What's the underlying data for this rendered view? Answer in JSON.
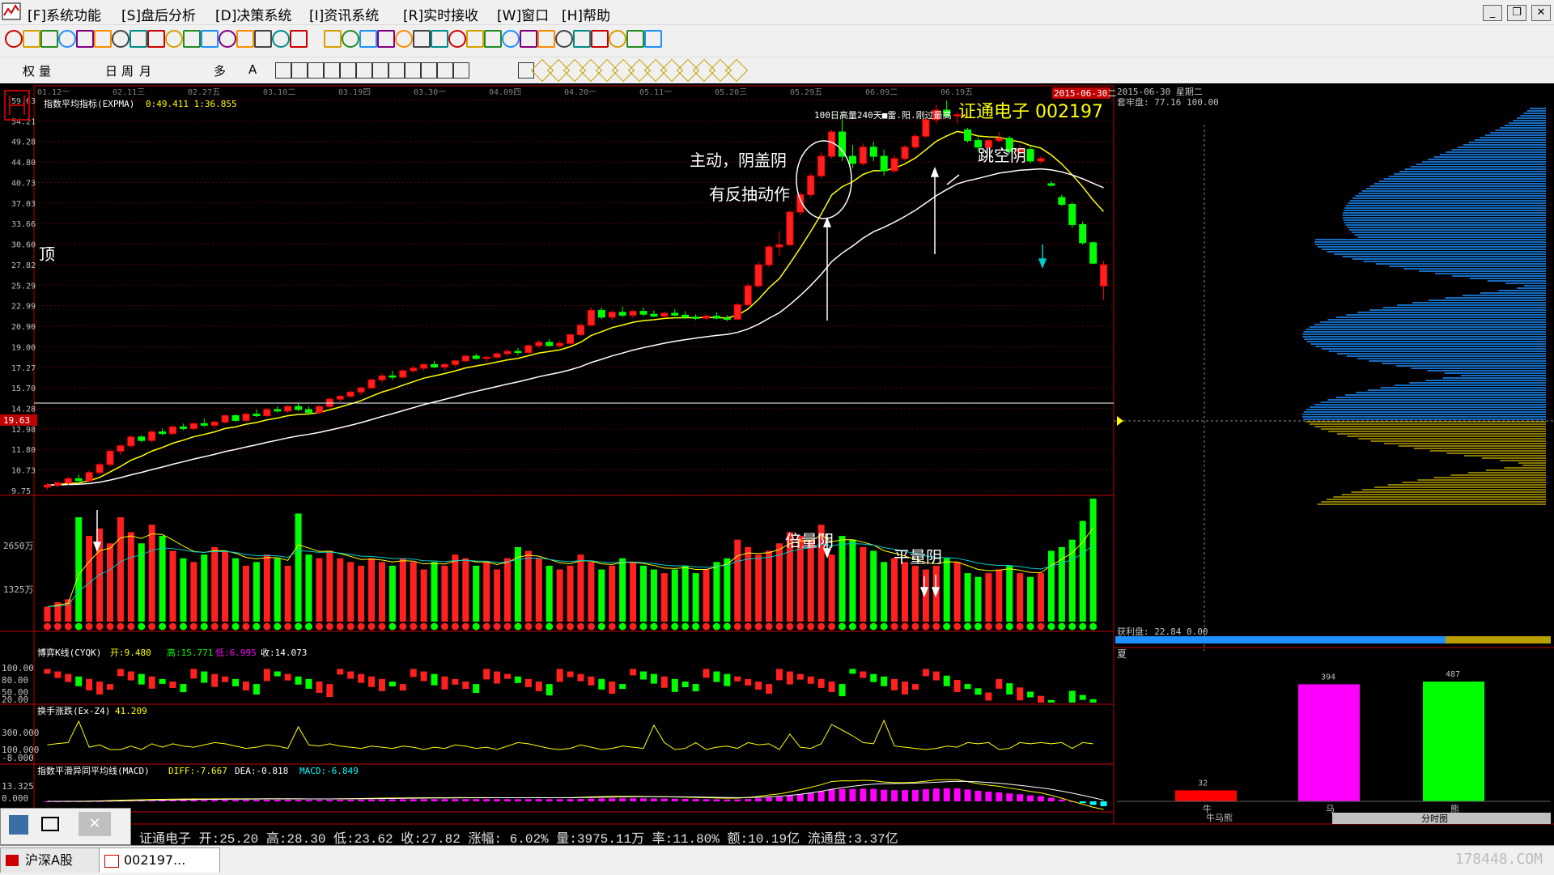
{
  "menu": {
    "items": [
      "[F]系统功能",
      "[S]盘后分析",
      "[D]决策系统",
      "[I]资讯系统",
      "[R]实时接收",
      "[W]窗口",
      "[H]帮助"
    ]
  },
  "toolbar2_text": {
    "fuquan": "权",
    "liang": "量",
    "day": "日",
    "week": "周",
    "month": "月",
    "duo": "多",
    "text_a": "A"
  },
  "chart": {
    "indicator_title": "指数平均指标(EXPMA)",
    "indicator_values": "0:49.411  1:36.855",
    "stock_title": "证通电子 002197",
    "top_note": "100日高量240天■雷.阳.刚过最高",
    "current_price_label": "19.63",
    "date_labels": [
      "01.12一",
      "02.11三",
      "02.27五",
      "03.10二",
      "03.19四",
      "03.30一",
      "04.09四",
      "04.20一",
      "05.11一",
      "05.20三",
      "05.29五",
      "06.09二",
      "06.19五"
    ],
    "highlight_date": "2015-06-30二",
    "price_ticks": [
      "59.63",
      "54.21",
      "49.28",
      "44.80",
      "40.73",
      "37.03",
      "33.66",
      "30.60",
      "27.82",
      "25.29",
      "22.99",
      "20.90",
      "19.00",
      "17.27",
      "15.70",
      "14.28",
      "12.98",
      "11.80",
      "10.73",
      "9.75"
    ],
    "volume_ticks": [
      "2650万",
      "1325万"
    ],
    "cyqk_title": "博弈K线(CYQK)",
    "cyqk_open": "开:9.480",
    "cyqk_high": "高:15.771",
    "cyqk_low": "低:6.995",
    "cyqk_close": "收:14.073",
    "cyqk_ticks": [
      "100.00",
      "80.00",
      "50.00",
      "20.00"
    ],
    "exz_title": "换手涨跌(Ex-Z4)",
    "exz_value": "41.209",
    "exz_ticks": [
      "300.000",
      "100.000",
      "-8.000"
    ],
    "macd_title": "指数平滑异同平均线(MACD)",
    "macd_diff": "DIFF:-7.667",
    "macd_dea": "DEA:-0.818",
    "macd_macd": "MACD:-6.849",
    "macd_ticks": [
      "13.325",
      "0.000"
    ]
  },
  "annotations": {
    "top_label": "顶",
    "zhudong": "主动，阴盖阴",
    "fanchou": "有反抽动作",
    "tiaokong": "跳空阴",
    "beiliang": "倍量阴",
    "pingliang": "平量阴"
  },
  "chip_panel": {
    "date_label": "2015-06-30 星期二",
    "taolao": "套牢盘: 77.16 100.00",
    "huoli": "获利盘: 22.84 0.00",
    "xia_label": "夏",
    "bars": [
      {
        "label": "牛",
        "value": "32",
        "color": "#ff0000"
      },
      {
        "label": "马",
        "value": "394",
        "color": "#ff00ff"
      },
      {
        "label": "熊",
        "value": "487",
        "color": "#00ff00"
      }
    ],
    "footer_left": "牛马熊",
    "footer_right": "分时图"
  },
  "status_bar": {
    "text": "证通电子 开:25.20 高:28.30 低:23.62 收:27.82 涨幅: 6.02% 量:3975.11万 率:11.80% 额:10.19亿 流通盘:3.37亿"
  },
  "taskbar": {
    "tab1": "沪深A股",
    "tab2": "002197..."
  },
  "watermark": "178448.COM",
  "chart_data": {
    "type": "candlestick",
    "candles": [
      [
        9.9,
        10.1,
        9.8,
        10.0
      ],
      [
        10.0,
        10.2,
        9.9,
        10.1
      ],
      [
        10.1,
        10.4,
        10.0,
        10.3
      ],
      [
        10.3,
        10.5,
        10.2,
        10.2
      ],
      [
        10.2,
        10.7,
        10.2,
        10.6
      ],
      [
        10.6,
        11.1,
        10.5,
        11.0
      ],
      [
        11.0,
        11.8,
        10.9,
        11.7
      ],
      [
        11.7,
        12.1,
        11.5,
        12.0
      ],
      [
        12.0,
        12.6,
        11.9,
        12.5
      ],
      [
        12.5,
        12.6,
        12.2,
        12.3
      ],
      [
        12.3,
        12.9,
        12.2,
        12.8
      ],
      [
        12.8,
        13.0,
        12.6,
        12.7
      ],
      [
        12.7,
        13.2,
        12.6,
        13.1
      ],
      [
        13.1,
        13.3,
        12.9,
        13.0
      ],
      [
        13.0,
        13.4,
        12.9,
        13.3
      ],
      [
        13.3,
        13.6,
        13.1,
        13.2
      ],
      [
        13.2,
        13.5,
        13.0,
        13.4
      ],
      [
        13.4,
        13.9,
        13.3,
        13.8
      ],
      [
        13.8,
        13.9,
        13.4,
        13.5
      ],
      [
        13.5,
        14.0,
        13.4,
        13.9
      ],
      [
        13.9,
        14.2,
        13.7,
        13.8
      ],
      [
        13.8,
        14.3,
        13.7,
        14.2
      ],
      [
        14.2,
        14.4,
        14.0,
        14.1
      ],
      [
        14.1,
        14.5,
        14.0,
        14.4
      ],
      [
        14.4,
        14.6,
        14.1,
        14.2
      ],
      [
        14.2,
        14.4,
        13.9,
        14.0
      ],
      [
        14.0,
        14.5,
        13.9,
        14.4
      ],
      [
        14.4,
        15.0,
        14.3,
        14.9
      ],
      [
        14.9,
        15.2,
        14.7,
        15.1
      ],
      [
        15.1,
        15.5,
        15.0,
        15.4
      ],
      [
        15.4,
        15.8,
        15.2,
        15.7
      ],
      [
        15.7,
        16.4,
        15.6,
        16.3
      ],
      [
        16.3,
        16.8,
        16.1,
        16.6
      ],
      [
        16.6,
        17.0,
        16.3,
        16.5
      ],
      [
        16.5,
        17.1,
        16.4,
        17.0
      ],
      [
        17.0,
        17.4,
        16.8,
        17.2
      ],
      [
        17.2,
        17.6,
        17.0,
        17.5
      ],
      [
        17.5,
        17.8,
        17.2,
        17.3
      ],
      [
        17.3,
        17.6,
        17.0,
        17.5
      ],
      [
        17.5,
        17.9,
        17.3,
        17.8
      ],
      [
        17.8,
        18.3,
        17.7,
        18.2
      ],
      [
        18.2,
        18.4,
        17.9,
        18.0
      ],
      [
        18.0,
        18.2,
        17.7,
        18.1
      ],
      [
        18.1,
        18.5,
        18.0,
        18.4
      ],
      [
        18.4,
        18.8,
        18.2,
        18.6
      ],
      [
        18.6,
        18.9,
        18.3,
        18.5
      ],
      [
        18.5,
        19.2,
        18.4,
        19.1
      ],
      [
        19.1,
        19.6,
        18.9,
        19.4
      ],
      [
        19.4,
        19.7,
        19.0,
        19.1
      ],
      [
        19.1,
        19.5,
        18.9,
        19.3
      ],
      [
        19.3,
        20.2,
        19.2,
        20.1
      ],
      [
        20.1,
        21.2,
        20.0,
        21.0
      ],
      [
        21.0,
        22.8,
        20.9,
        22.5
      ],
      [
        22.5,
        22.8,
        21.6,
        21.8
      ],
      [
        21.8,
        22.5,
        21.5,
        22.3
      ],
      [
        22.3,
        22.9,
        21.8,
        22.0
      ],
      [
        22.0,
        22.6,
        21.7,
        22.4
      ],
      [
        22.4,
        22.8,
        21.9,
        22.1
      ],
      [
        22.1,
        22.5,
        21.8,
        21.9
      ],
      [
        21.9,
        22.4,
        21.7,
        22.2
      ],
      [
        22.2,
        22.6,
        21.9,
        22.0
      ],
      [
        22.0,
        22.4,
        21.6,
        21.8
      ],
      [
        21.8,
        22.1,
        21.5,
        21.7
      ],
      [
        21.7,
        22.1,
        21.5,
        21.9
      ],
      [
        21.9,
        22.3,
        21.6,
        21.7
      ],
      [
        21.7,
        22.0,
        21.4,
        21.6
      ],
      [
        21.6,
        23.3,
        21.5,
        23.1
      ],
      [
        23.1,
        25.5,
        23.0,
        25.2
      ],
      [
        25.2,
        28.2,
        25.0,
        27.8
      ],
      [
        27.8,
        30.5,
        27.5,
        30.2
      ],
      [
        30.2,
        32.5,
        29.0,
        30.5
      ],
      [
        30.5,
        35.8,
        30.3,
        35.5
      ],
      [
        35.5,
        39.0,
        35.0,
        38.5
      ],
      [
        38.5,
        42.5,
        38.0,
        42.0
      ],
      [
        42.0,
        46.8,
        41.5,
        46.0
      ],
      [
        46.0,
        52.0,
        45.5,
        51.5
      ],
      [
        51.5,
        56.0,
        45.0,
        46.0
      ],
      [
        46.0,
        48.5,
        43.5,
        44.5
      ],
      [
        44.5,
        48.8,
        44.0,
        48.0
      ],
      [
        48.0,
        49.2,
        45.0,
        46.0
      ],
      [
        46.0,
        47.5,
        42.0,
        43.0
      ],
      [
        43.0,
        46.2,
        42.5,
        45.5
      ],
      [
        45.5,
        48.5,
        45.0,
        48.0
      ],
      [
        48.0,
        51.0,
        47.5,
        50.5
      ],
      [
        50.5,
        55.0,
        50.0,
        54.5
      ],
      [
        54.5,
        58.5,
        53.5,
        57.0
      ],
      [
        57.0,
        59.6,
        55.0,
        55.5
      ],
      [
        55.5,
        56.5,
        53.5,
        55.8
      ],
      [
        52.0,
        52.5,
        49.0,
        49.5
      ],
      [
        49.5,
        50.2,
        47.0,
        48.0
      ],
      [
        48.0,
        49.8,
        47.5,
        49.5
      ],
      [
        49.5,
        51.5,
        49.0,
        50.0
      ],
      [
        50.0,
        50.5,
        46.5,
        47.0
      ],
      [
        47.0,
        48.5,
        46.0,
        47.5
      ],
      [
        47.5,
        48.5,
        44.5,
        45.0
      ],
      [
        45.0,
        46.0,
        44.5,
        45.5
      ],
      [
        40.5,
        41.0,
        40.0,
        40.2
      ],
      [
        38.0,
        38.5,
        36.5,
        36.8
      ],
      [
        36.8,
        37.2,
        33.0,
        33.5
      ],
      [
        33.5,
        34.0,
        30.5,
        30.8
      ],
      [
        30.8,
        31.0,
        27.9,
        28.0
      ],
      [
        25.2,
        28.3,
        23.6,
        27.8
      ]
    ],
    "volumes": [
      400,
      520,
      600,
      2800,
      2300,
      2500,
      2100,
      2800,
      2400,
      2100,
      2600,
      2300,
      1900,
      1700,
      1600,
      1800,
      2000,
      1900,
      1700,
      1500,
      1600,
      1800,
      1700,
      1500,
      2900,
      1800,
      1700,
      1900,
      1700,
      1600,
      1500,
      1700,
      1600,
      1500,
      1700,
      1600,
      1400,
      1600,
      1500,
      1800,
      1700,
      1500,
      1600,
      1400,
      1700,
      2000,
      1900,
      1700,
      1500,
      1400,
      1500,
      1800,
      1600,
      1400,
      1500,
      1700,
      1600,
      1500,
      1400,
      1300,
      1400,
      1500,
      1300,
      1400,
      1600,
      1700,
      2200,
      2000,
      1800,
      1900,
      2100,
      2400,
      2300,
      2200,
      2600,
      1800,
      2300,
      2200,
      2000,
      1900,
      1600,
      1700,
      1600,
      1500,
      1400,
      1500,
      1700,
      1600,
      1300,
      1200,
      1300,
      1400,
      1500,
      1300,
      1200,
      1300,
      1900,
      2000,
      2200,
      2700,
      3300
    ]
  },
  "colors": {
    "up": "#ff0000",
    "down": "#00ff00",
    "ma1": "#ffff00",
    "ma2": "#ffffff",
    "chip_blue": "#1e90ff",
    "chip_yellow": "#b8a000",
    "grid": "#800000",
    "axis_red": "#c00000"
  }
}
